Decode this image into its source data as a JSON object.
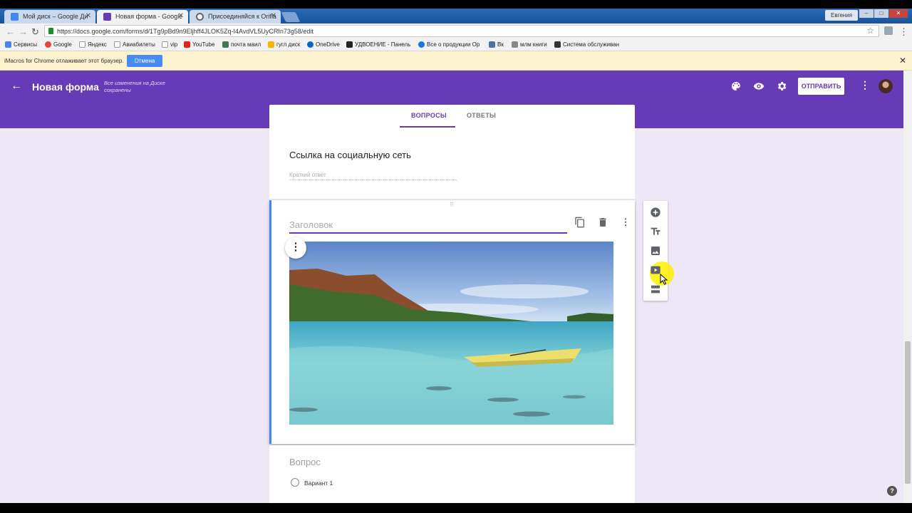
{
  "browser": {
    "tabs": [
      {
        "label": "Мой диск – Google Ди",
        "active": false,
        "favicon_color": "#4285f4"
      },
      {
        "label": "Новая форма - Google",
        "active": true,
        "favicon_color": "#673ab7"
      },
      {
        "label": "Присоединяйся к Orifla",
        "active": false,
        "favicon_color": "#666666"
      }
    ],
    "user": "Евгения",
    "url": "https://docs.google.com/forms/d/1Tg9pBd9n9Eljhff4JLOK5Zq-I4AvdVL5UyCRIn73g58/edit",
    "bookmarks": [
      {
        "label": "Сервисы",
        "color": "#4285f4"
      },
      {
        "label": "Google",
        "color": "#ea4335"
      },
      {
        "label": "Яндекс",
        "color": "#ffffff"
      },
      {
        "label": "Авиабилеты",
        "color": "#ffffff"
      },
      {
        "label": "vip",
        "color": "#ffffff"
      },
      {
        "label": "YouTube",
        "color": "#e62117"
      },
      {
        "label": "почта маил",
        "color": "#3b7a57"
      },
      {
        "label": "гугл диск",
        "color": "#f4b400"
      },
      {
        "label": "OneDrive",
        "color": "#0a64c8"
      },
      {
        "label": "УДВОЕНИЕ - Панель",
        "color": "#222222"
      },
      {
        "label": "Все о продукции Ор",
        "color": "#1a73e8"
      },
      {
        "label": "Вк",
        "color": "#4c75a3"
      },
      {
        "label": "млм книги",
        "color": "#888888"
      },
      {
        "label": "Система обслуживан",
        "color": "#333333"
      }
    ],
    "infobar": {
      "message": "iMacros for Chrome отлаживает этот браузер.",
      "button": "Отмена"
    }
  },
  "forms": {
    "title": "Новая форма",
    "saved_status": "Все изменения на Диске сохранены",
    "send_label": "ОТПРАВИТЬ",
    "tabs": {
      "questions": "ВОПРОСЫ",
      "answers": "ОТВЕТЫ"
    },
    "question1": {
      "title": "Ссылка на социальную сеть",
      "placeholder": "Краткий ответ"
    },
    "image_block": {
      "title_placeholder": "Заголовок"
    },
    "question3": {
      "title": "Вопрос",
      "option": "Вариант 1"
    },
    "accent_color": "#673ab7",
    "help": "?"
  }
}
